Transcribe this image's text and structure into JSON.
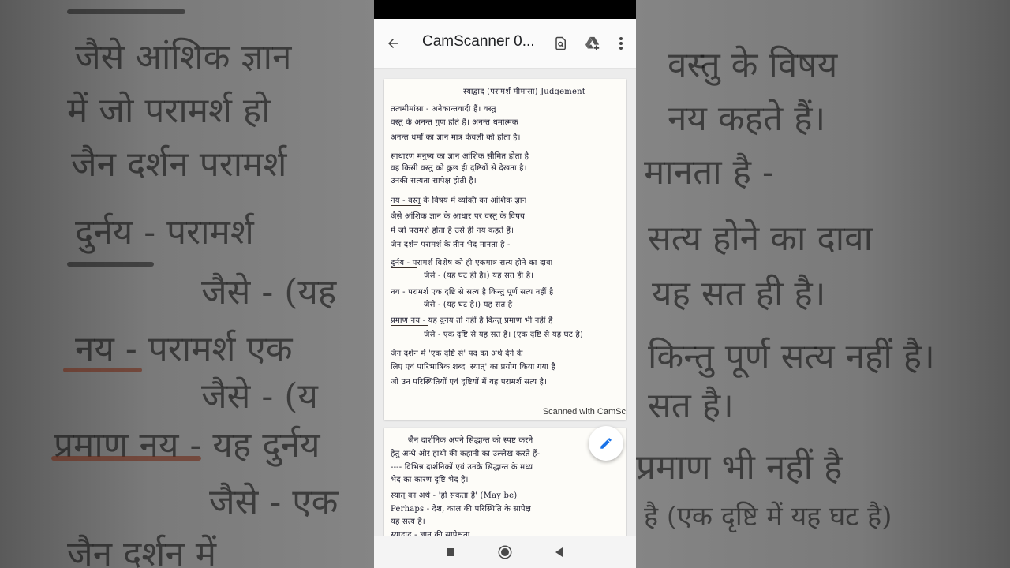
{
  "app_bar": {
    "title": "CamScanner 0...",
    "back_icon": "arrow-back-icon",
    "actions": [
      "document-search-icon",
      "drive-add-icon",
      "more-vert-icon"
    ]
  },
  "document": {
    "page1_lines": [
      "स्याद्वाद (परामर्श मीमांसा) Judgement",
      "तत्वमीमांसा - अनेकान्तवादी हैं। वस्तु",
      "वस्तु के अनन्त गुण होते हैं। अनन्त धर्मात्मक",
      "अनन्त धर्मों का ज्ञान मात्र केवली को होता है।",
      "साधारण मनुष्य का ज्ञान आंशिक सीमित होता है",
      "वह किसी वस्तु को कुछ ही दृष्टियों से देखता है।",
      "उनकी सत्यता सापेक्ष होती है।",
      "नय - वस्तु के विषय में व्यक्ति का आंशिक ज्ञान",
      "जैसे आंशिक ज्ञान के आधार पर वस्तु के विषय",
      "में जो परामर्श होता है उसे ही नय कहते हैं।",
      "जैन दर्शन परामर्श के तीन भेद मानता है -",
      "दुर्नय - परामर्श विशेष को ही एकमात्र सत्य होने का दावा",
      "जैसे - (यह घट ही है।) यह सत ही है।",
      "नय - परामर्श एक दृष्टि से सत्य है किन्तु पूर्ण सत्य नहीं है",
      "जैसे - (यह घट है।) यह सत है।",
      "प्रमाण नय - यह दुर्नय तो नहीं है किन्तु प्रमाण भी नहीं है",
      "जैसे - एक दृष्टि से यह सत है। (एक दृष्टि से यह घट है)",
      "जैन दर्शन में 'एक दृष्टि से' पद का अर्थ देने के",
      "लिए एवं पारिभाषिक शब्द 'स्यात्' का प्रयोग किया गया है",
      "जो उन परिस्थितियों एवं दृष्टियों में यह परामर्श सत्य है।"
    ],
    "watermark": "Scanned with CamSc",
    "page2_lines": [
      "जैन दार्शनिक अपने सिद्धान्त को स्पष्ट करने",
      "हेतु अन्धे और हाथी की कहानी का उल्लेख करते हैं-",
      "---- विभिन्न दार्शनिकों एवं उनके सिद्धान्त के मध्य",
      "भेद का कारण दृष्टि भेद है।",
      "स्यात् का अर्थ - 'हो सकता है' (May be)",
      "Perhaps - देश, काल की परिस्थिति के सापेक्ष",
      "यह सत्य है।",
      "स्याद्वाद - ज्ञान की सापेक्षता"
    ]
  },
  "fab": {
    "icon": "edit-pencil-icon"
  },
  "nav": [
    "recents-square-icon",
    "home-circle-icon",
    "back-triangle-icon"
  ],
  "background_words": [
    "जैसे आंशिक ज्ञान",
    "में जो परामर्श हो",
    "जैन दर्शन परामर्श",
    "दुर्नय - परामर्श",
    "जैसे - (यह",
    "नय - परामर्श एक",
    "जैसे - (य",
    "प्रमाण नय - यह दुर्नय",
    "जैसे - एक",
    "जैन दर्शन में",
    "वस्तु के विषय",
    "नय कहते हैं।",
    "मानता है -",
    "सत्य होने का दावा",
    "यह सत ही है।",
    "किन्तु पूर्ण सत्य नहीं है।",
    "सत है।",
    "प्रमाण भी नहीं है",
    "है (एक दृष्टि में यह घट है)"
  ]
}
